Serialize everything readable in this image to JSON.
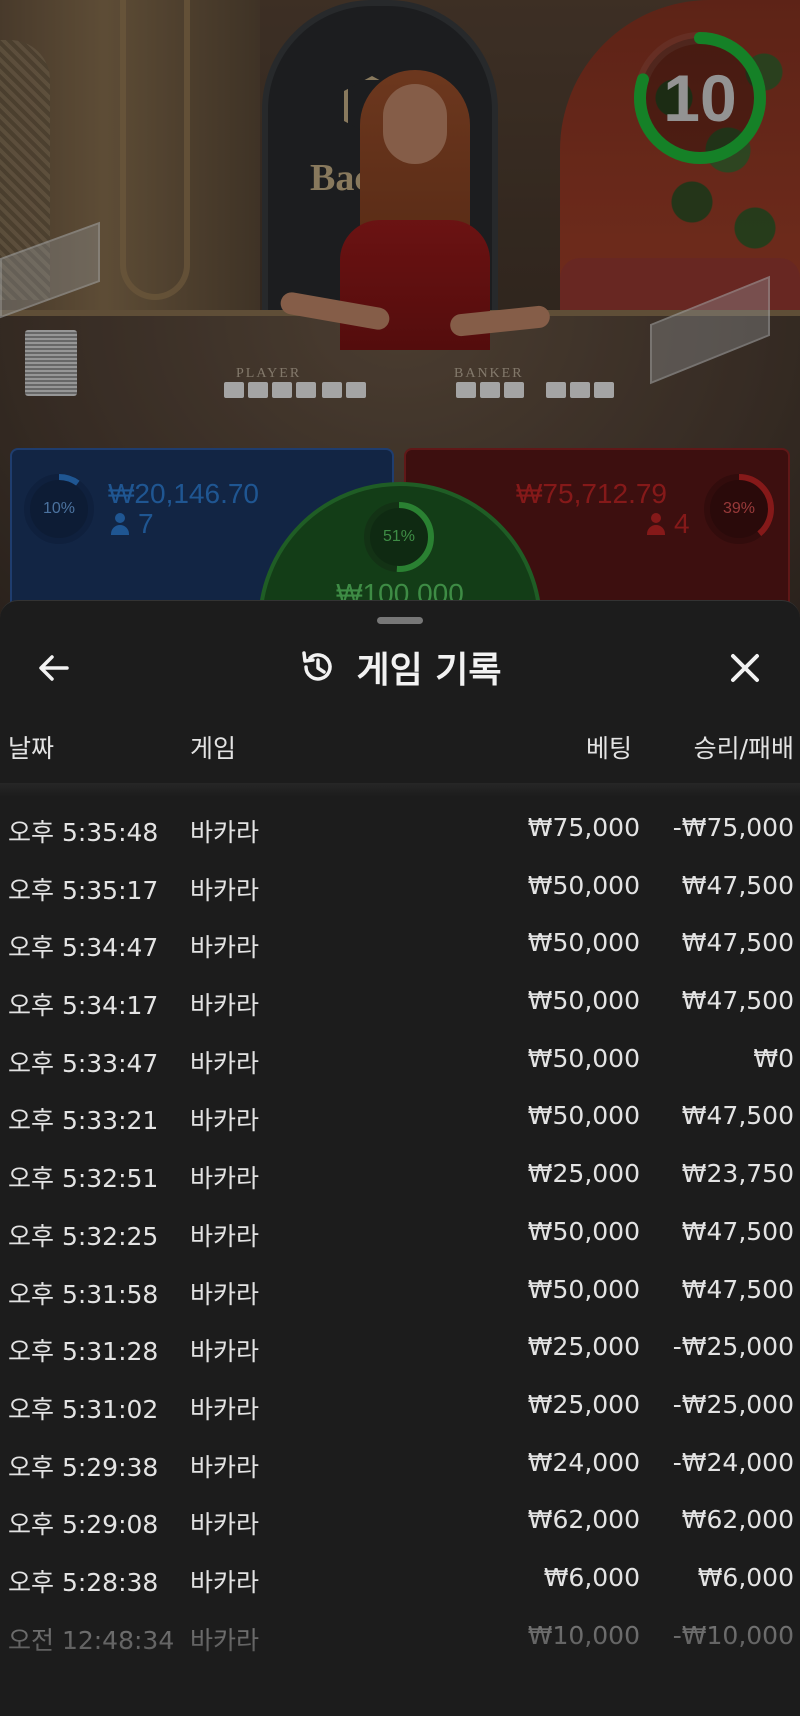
{
  "scene": {
    "logo_text": "Bac",
    "felt_player_label": "PLAYER",
    "felt_banker_label": "BANKER",
    "timer": {
      "value": "10",
      "progress": 0.8,
      "color": "#1fbf3a"
    },
    "player": {
      "percent": "10%",
      "percent_value": 0.1,
      "amount": "₩20,146.70",
      "users": "7",
      "color": "#2f7fd8"
    },
    "banker": {
      "percent": "39%",
      "percent_value": 0.39,
      "amount": "₩75,712.79",
      "users": "4",
      "color": "#c42626"
    },
    "tie": {
      "percent": "51%",
      "percent_value": 0.51,
      "amount": "₩100,000",
      "color": "#3fbf4a"
    }
  },
  "sheet": {
    "title": "게임 기록",
    "icons": {
      "back": "arrow-left-icon",
      "history": "history-icon",
      "close": "close-icon"
    },
    "columns": {
      "date": "날짜",
      "game": "게임",
      "bet": "베팅",
      "win_loss": "승리/패배"
    },
    "rows": [
      {
        "date": "오후 5:35:48",
        "game": "바카라",
        "bet": "₩75,000",
        "win": "-₩75,000"
      },
      {
        "date": "오후 5:35:17",
        "game": "바카라",
        "bet": "₩50,000",
        "win": "₩47,500"
      },
      {
        "date": "오후 5:34:47",
        "game": "바카라",
        "bet": "₩50,000",
        "win": "₩47,500"
      },
      {
        "date": "오후 5:34:17",
        "game": "바카라",
        "bet": "₩50,000",
        "win": "₩47,500"
      },
      {
        "date": "오후 5:33:47",
        "game": "바카라",
        "bet": "₩50,000",
        "win": "₩0"
      },
      {
        "date": "오후 5:33:21",
        "game": "바카라",
        "bet": "₩50,000",
        "win": "₩47,500"
      },
      {
        "date": "오후 5:32:51",
        "game": "바카라",
        "bet": "₩25,000",
        "win": "₩23,750"
      },
      {
        "date": "오후 5:32:25",
        "game": "바카라",
        "bet": "₩50,000",
        "win": "₩47,500"
      },
      {
        "date": "오후 5:31:58",
        "game": "바카라",
        "bet": "₩50,000",
        "win": "₩47,500"
      },
      {
        "date": "오후 5:31:28",
        "game": "바카라",
        "bet": "₩25,000",
        "win": "-₩25,000"
      },
      {
        "date": "오후 5:31:02",
        "game": "바카라",
        "bet": "₩25,000",
        "win": "-₩25,000"
      },
      {
        "date": "오후 5:29:38",
        "game": "바카라",
        "bet": "₩24,000",
        "win": "-₩24,000"
      },
      {
        "date": "오후 5:29:08",
        "game": "바카라",
        "bet": "₩62,000",
        "win": "₩62,000"
      },
      {
        "date": "오후 5:28:38",
        "game": "바카라",
        "bet": "₩6,000",
        "win": "₩6,000"
      },
      {
        "date": "오전 12:48:34",
        "game": "바카라",
        "bet": "₩10,000",
        "win": "-₩10,000"
      }
    ]
  }
}
